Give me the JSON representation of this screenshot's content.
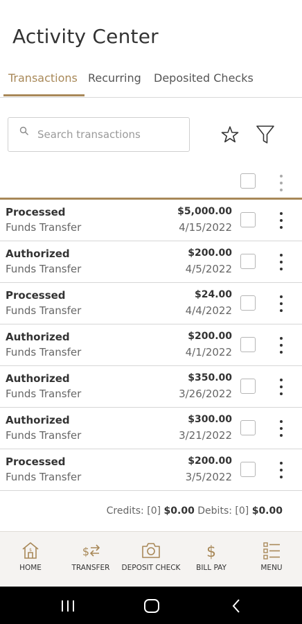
{
  "header": {
    "title": "Activity Center"
  },
  "tabs": [
    {
      "label": "Transactions",
      "active": true
    },
    {
      "label": "Recurring",
      "active": false
    },
    {
      "label": "Deposited Checks",
      "active": false
    }
  ],
  "search": {
    "placeholder": "Search transactions",
    "value": ""
  },
  "transactions": [
    {
      "status": "Processed",
      "type": "Funds Transfer",
      "amount": "$5,000.00",
      "date": "4/15/2022"
    },
    {
      "status": "Authorized",
      "type": "Funds Transfer",
      "amount": "$200.00",
      "date": "4/5/2022"
    },
    {
      "status": "Processed",
      "type": "Funds Transfer",
      "amount": "$24.00",
      "date": "4/4/2022"
    },
    {
      "status": "Authorized",
      "type": "Funds Transfer",
      "amount": "$200.00",
      "date": "4/1/2022"
    },
    {
      "status": "Authorized",
      "type": "Funds Transfer",
      "amount": "$350.00",
      "date": "3/26/2022"
    },
    {
      "status": "Authorized",
      "type": "Funds Transfer",
      "amount": "$300.00",
      "date": "3/21/2022"
    },
    {
      "status": "Processed",
      "type": "Funds Transfer",
      "amount": "$200.00",
      "date": "3/5/2022"
    }
  ],
  "totals": {
    "credits_label": "Credits:",
    "credits_count": "[0]",
    "credits_amount": "$0.00",
    "debits_label": "Debits:",
    "debits_count": "[0]",
    "debits_amount": "$0.00"
  },
  "bottom_nav": [
    {
      "label": "HOME",
      "icon": "home-icon"
    },
    {
      "label": "TRANSFER",
      "icon": "transfer-icon"
    },
    {
      "label": "DEPOSIT CHECK",
      "icon": "camera-icon"
    },
    {
      "label": "BILL PAY",
      "icon": "dollar-icon"
    },
    {
      "label": "MENU",
      "icon": "menu-list-icon"
    }
  ],
  "colors": {
    "accent": "#a88858",
    "nav_background": "#f5f3f1",
    "system_bar": "#000000"
  }
}
